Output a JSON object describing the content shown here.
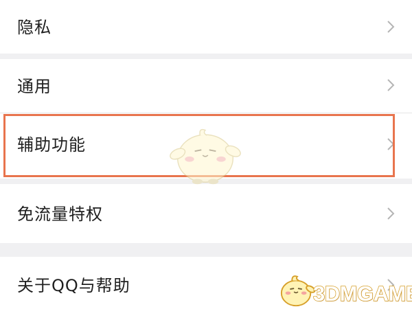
{
  "menu": {
    "items": [
      {
        "label": "隐私"
      },
      {
        "label": "通用"
      },
      {
        "label": "辅助功能"
      },
      {
        "label": "免流量特权"
      },
      {
        "label": "关于QQ与帮助"
      }
    ]
  },
  "highlight": {
    "target": "辅助功能",
    "color": "#e8744d"
  },
  "watermark": {
    "text": "3DMGAME",
    "color": "#d7a02a"
  },
  "icons": {
    "row_arrow": "chevron-right-icon",
    "mascot": "qq-mascot-icon"
  }
}
